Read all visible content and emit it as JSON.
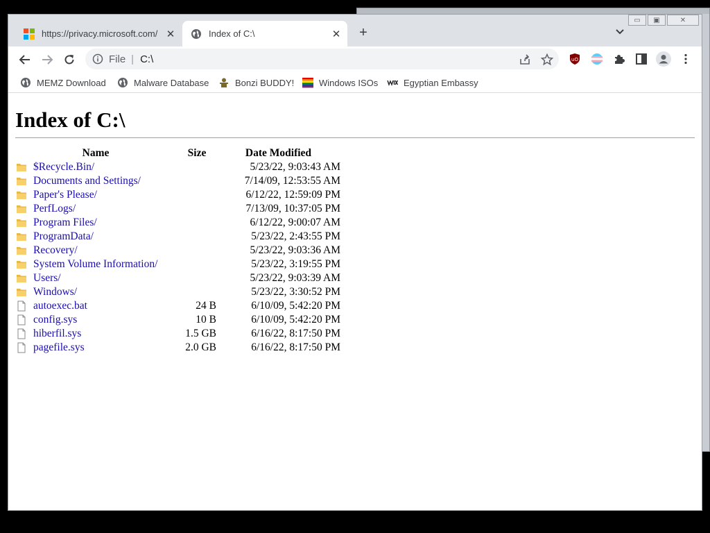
{
  "tabs": [
    {
      "title": "https://privacy.microsoft.com/",
      "icon": "microsoft-logo-icon"
    },
    {
      "title": "Index of C:\\",
      "icon": "globe-icon",
      "active": true
    }
  ],
  "omnibox": {
    "prefix": "File",
    "url": "C:\\"
  },
  "bookmarks": [
    {
      "label": "MEMZ Download",
      "icon": "globe-icon"
    },
    {
      "label": "Malware Database",
      "icon": "globe-icon"
    },
    {
      "label": "Bonzi BUDDY!",
      "icon": "bonzi-icon"
    },
    {
      "label": "Windows ISOs",
      "icon": "rainbow-flag-icon"
    },
    {
      "label": "Egyptian Embassy",
      "icon": "wix-icon"
    }
  ],
  "page": {
    "heading": "Index of C:\\",
    "columns": {
      "name": "Name",
      "size": "Size",
      "date": "Date Modified"
    },
    "entries": [
      {
        "name": "$Recycle.Bin/",
        "size": "",
        "date": "5/23/22, 9:03:43 AM",
        "type": "folder"
      },
      {
        "name": "Documents and Settings/",
        "size": "",
        "date": "7/14/09, 12:53:55 AM",
        "type": "folder"
      },
      {
        "name": "Paper's Please/",
        "size": "",
        "date": "6/12/22, 12:59:09 PM",
        "type": "folder"
      },
      {
        "name": "PerfLogs/",
        "size": "",
        "date": "7/13/09, 10:37:05 PM",
        "type": "folder"
      },
      {
        "name": "Program Files/",
        "size": "",
        "date": "6/12/22, 9:00:07 AM",
        "type": "folder"
      },
      {
        "name": "ProgramData/",
        "size": "",
        "date": "5/23/22, 2:43:55 PM",
        "type": "folder"
      },
      {
        "name": "Recovery/",
        "size": "",
        "date": "5/23/22, 9:03:36 AM",
        "type": "folder"
      },
      {
        "name": "System Volume Information/",
        "size": "",
        "date": "5/23/22, 3:19:55 PM",
        "type": "folder"
      },
      {
        "name": "Users/",
        "size": "",
        "date": "5/23/22, 9:03:39 AM",
        "type": "folder"
      },
      {
        "name": "Windows/",
        "size": "",
        "date": "5/23/22, 3:30:52 PM",
        "type": "folder"
      },
      {
        "name": "autoexec.bat",
        "size": "24 B",
        "date": "6/10/09, 5:42:20 PM",
        "type": "file"
      },
      {
        "name": "config.sys",
        "size": "10 B",
        "date": "6/10/09, 5:42:20 PM",
        "type": "file"
      },
      {
        "name": "hiberfil.sys",
        "size": "1.5 GB",
        "date": "6/16/22, 8:17:50 PM",
        "type": "file"
      },
      {
        "name": "pagefile.sys",
        "size": "2.0 GB",
        "date": "6/16/22, 8:17:50 PM",
        "type": "file"
      }
    ]
  },
  "colors": {
    "link": "#1a0dab",
    "folder": "#f5c542",
    "titlebar": "#dee1e6"
  }
}
